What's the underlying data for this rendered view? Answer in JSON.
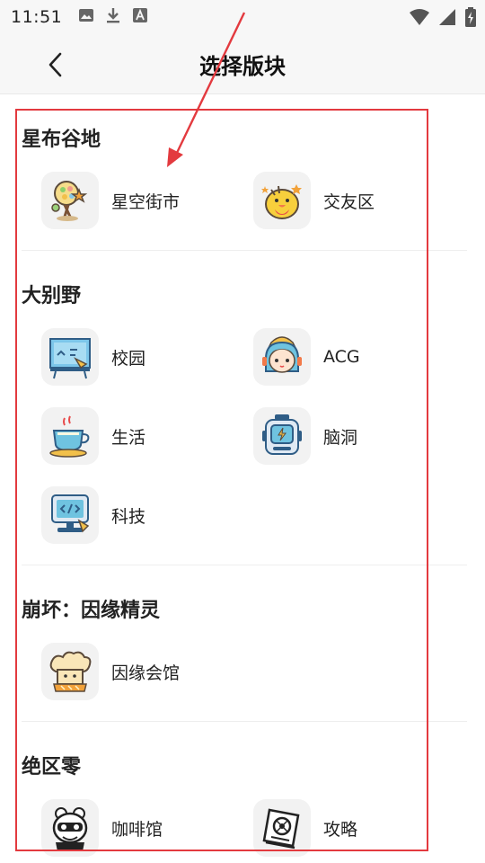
{
  "status_bar": {
    "time": "11:51",
    "left_icons": [
      "image-icon",
      "download-icon",
      "a-box-icon"
    ],
    "right_icons": [
      "wifi-icon",
      "signal-icon",
      "battery-icon"
    ]
  },
  "header": {
    "title": "选择版块",
    "back_icon": "chevron-left-icon"
  },
  "sections": [
    {
      "title": "星布谷地",
      "items": [
        {
          "label": "星空街市",
          "icon": "market-icon"
        },
        {
          "label": "交友区",
          "icon": "chick-icon"
        }
      ]
    },
    {
      "title": "大别野",
      "items": [
        {
          "label": "校园",
          "icon": "blackboard-icon"
        },
        {
          "label": "ACG",
          "icon": "anime-girl-icon"
        },
        {
          "label": "生活",
          "icon": "teacup-icon"
        },
        {
          "label": "脑洞",
          "icon": "robot-icon"
        },
        {
          "label": "科技",
          "icon": "computer-icon"
        }
      ]
    },
    {
      "title": "崩坏：因缘精灵",
      "items": [
        {
          "label": "因缘会馆",
          "icon": "chef-hat-icon"
        }
      ]
    },
    {
      "title": "绝区零",
      "items": [
        {
          "label": "咖啡馆",
          "icon": "mascot-icon"
        },
        {
          "label": "攻略",
          "icon": "book-icon"
        }
      ]
    }
  ],
  "colors": {
    "annotation_red": "#e33a3f",
    "icon_bg": "#f2f2f2",
    "bar_bg": "#f7f7f7"
  }
}
